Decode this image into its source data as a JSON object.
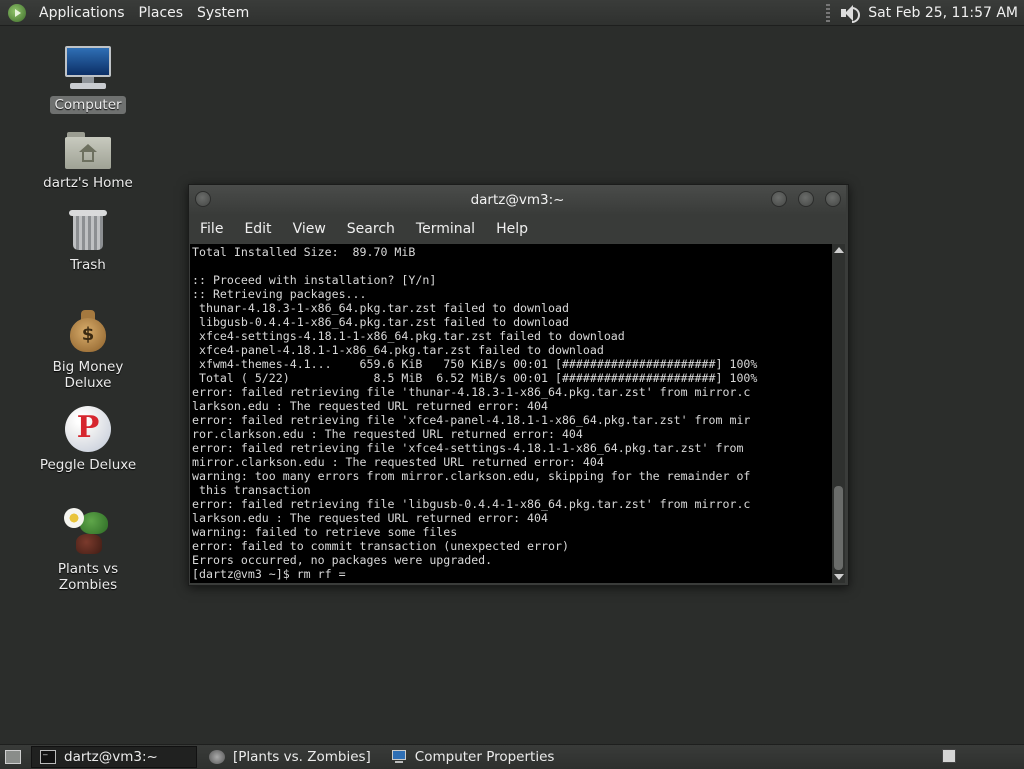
{
  "top_panel": {
    "menus": [
      "Applications",
      "Places",
      "System"
    ],
    "clock": "Sat Feb 25, 11:57 AM",
    "icons": {
      "logo": "distro-logo-icon",
      "volume": "speaker-icon"
    }
  },
  "desktop": {
    "icons": [
      {
        "label": "Computer",
        "icon": "computer-icon",
        "selected": true
      },
      {
        "label": "dartz's Home",
        "icon": "home-folder-icon"
      },
      {
        "label": "Trash",
        "icon": "trash-icon"
      },
      {
        "label": "Big Money Deluxe",
        "icon": "money-bag-icon"
      },
      {
        "label": "Peggle Deluxe",
        "icon": "peggle-icon"
      },
      {
        "label": "Plants vs Zombies",
        "icon": "plants-vs-zombies-icon"
      }
    ]
  },
  "terminal": {
    "title": "dartz@vm3:~",
    "menu": [
      "File",
      "Edit",
      "View",
      "Search",
      "Terminal",
      "Help"
    ],
    "lines": [
      "Total Installed Size:  89.70 MiB",
      "",
      ":: Proceed with installation? [Y/n]",
      ":: Retrieving packages...",
      " thunar-4.18.3-1-x86_64.pkg.tar.zst failed to download",
      " libgusb-0.4.4-1-x86_64.pkg.tar.zst failed to download",
      " xfce4-settings-4.18.1-1-x86_64.pkg.tar.zst failed to download",
      " xfce4-panel-4.18.1-1-x86_64.pkg.tar.zst failed to download",
      " xfwm4-themes-4.1...    659.6 KiB   750 KiB/s 00:01 [######################] 100%",
      " Total ( 5/22)            8.5 MiB  6.52 MiB/s 00:01 [######################] 100%",
      "error: failed retrieving file 'thunar-4.18.3-1-x86_64.pkg.tar.zst' from mirror.c",
      "larkson.edu : The requested URL returned error: 404",
      "error: failed retrieving file 'xfce4-panel-4.18.1-1-x86_64.pkg.tar.zst' from mir",
      "ror.clarkson.edu : The requested URL returned error: 404",
      "error: failed retrieving file 'xfce4-settings-4.18.1-1-x86_64.pkg.tar.zst' from",
      "mirror.clarkson.edu : The requested URL returned error: 404",
      "warning: too many errors from mirror.clarkson.edu, skipping for the remainder of",
      " this transaction",
      "error: failed retrieving file 'libgusb-0.4.4-1-x86_64.pkg.tar.zst' from mirror.c",
      "larkson.edu : The requested URL returned error: 404",
      "warning: failed to retrieve some files",
      "error: failed to commit transaction (unexpected error)",
      "Errors occurred, no packages were upgraded.",
      "[dartz@vm3 ~]$ rm rf ="
    ]
  },
  "taskbar": {
    "tasks": [
      {
        "label": "dartz@vm3:~",
        "icon": "terminal-icon",
        "active": true
      },
      {
        "label": "[Plants vs. Zombies]",
        "icon": "plants-vs-zombies-icon"
      },
      {
        "label": "Computer Properties",
        "icon": "computer-icon"
      }
    ]
  },
  "colors": {
    "desktop_bg": "#2b2d2b",
    "terminal_bg": "#000000",
    "terminal_fg": "#d8d8d8"
  }
}
